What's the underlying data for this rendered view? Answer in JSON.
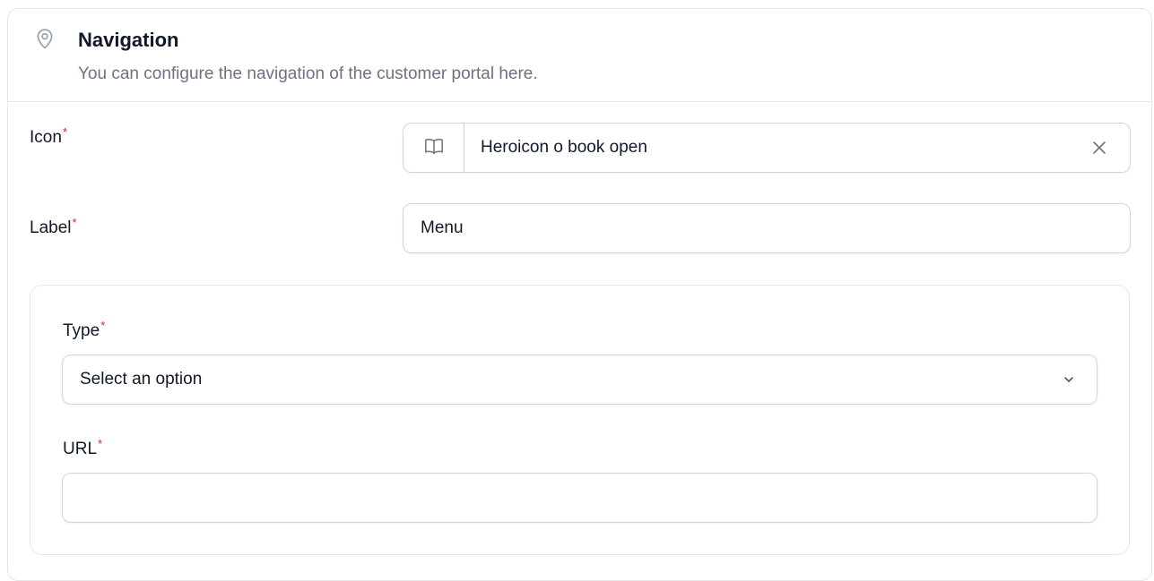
{
  "section": {
    "title": "Navigation",
    "description": "You can configure the navigation of the customer portal here.",
    "icon": "map-pin-icon"
  },
  "fields": {
    "icon": {
      "label": "Icon",
      "required_mark": "*",
      "value": "Heroicon o book open",
      "prefix_icon": "book-open-icon",
      "clear_icon": "close-icon"
    },
    "label": {
      "label": "Label",
      "required_mark": "*",
      "value": "Menu"
    },
    "type": {
      "label": "Type",
      "required_mark": "*",
      "selected": "Select an option",
      "dropdown_icon": "chevron-down-icon"
    },
    "url": {
      "label": "URL",
      "required_mark": "*",
      "value": ""
    }
  },
  "colors": {
    "required": "#dc2626",
    "border": "#d1d5db",
    "divider": "#e5e7eb",
    "muted_text": "#6b7280"
  }
}
